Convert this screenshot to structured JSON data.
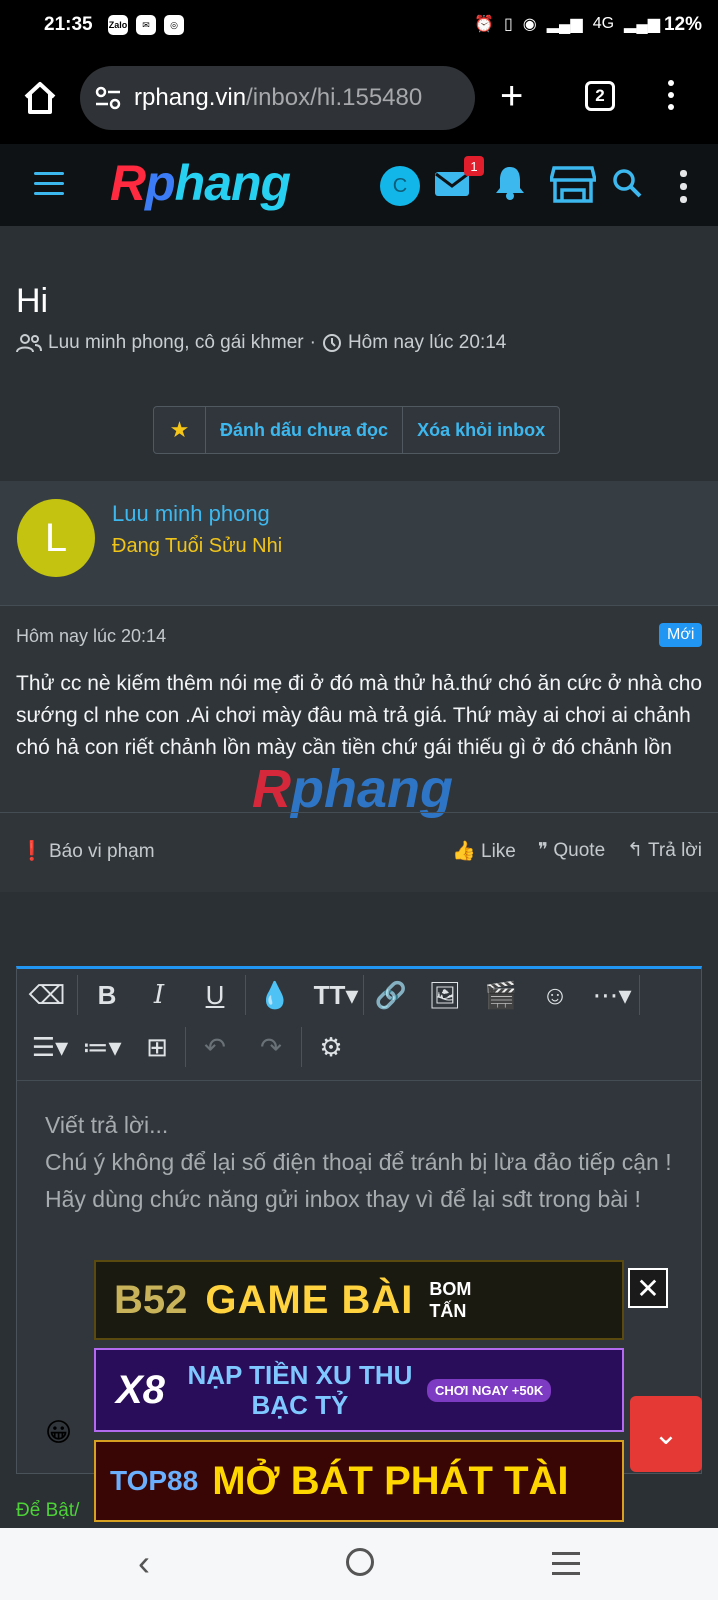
{
  "status_bar": {
    "time": "21:35",
    "network": "4G",
    "battery": "12%",
    "app_icons": [
      "Zalo",
      "Messenger",
      "Instagram"
    ]
  },
  "browser": {
    "url_host": "rphang.vin",
    "url_path": "/inbox/hi.155480",
    "tab_count": "2"
  },
  "site": {
    "logo_r": "R",
    "logo_p": "p",
    "logo_rest": "hang",
    "avatar_letter": "C",
    "mail_badge": "1"
  },
  "thread": {
    "title": "Hi",
    "participants": "Luu minh phong, cô gái khmer",
    "separator": "·",
    "time": "Hôm nay lúc 20:14",
    "buttons": {
      "mark_unread": "Đánh dấu chưa đọc",
      "remove": "Xóa khỏi inbox"
    }
  },
  "post": {
    "avatar_letter": "L",
    "author": "Luu minh phong",
    "user_title": "Đang Tuổi Sửu Nhi",
    "date": "Hôm nay lúc 20:14",
    "new_badge": "Mới",
    "body": "Thử cc nè kiếm thêm nói mẹ đi ở đó mà thử hả.thứ chó ăn cức ở nhà cho sướng cl nhe con .Ai chơi mày đâu mà trả giá. Thứ mày ai chơi ai chảnh chó hả con riết chảnh lồn mày cần tiền chứ gái thiếu gì ở đó chảnh lồn",
    "watermark_r": "R",
    "watermark_rest": "phang",
    "report": "Báo vi phạm",
    "like": "Like",
    "quote": "Quote",
    "reply": "Trả lời"
  },
  "editor": {
    "placeholder_line1": "Viết trả lời...",
    "placeholder_line2": "Chú ý không để lại số điện thoại để tránh bị lừa đảo tiếp cận !",
    "placeholder_line3": "Hãy dùng chức năng gửi inbox thay vì để lại sđt trong bài !"
  },
  "ads": {
    "ad1_brand": "B52",
    "ad1_text": "GAME BÀI",
    "ad1_tag": "BOM TẤN",
    "ad2_brand": "X8",
    "ad2_text": "NẠP TIỀN XU THU BẠC TỶ",
    "ad2_tag": "CHƠI NGAY +50K",
    "ad3_brand": "TOP88",
    "ad3_text": "MỞ BÁT PHÁT TÀI"
  },
  "hint": "Để Bật/",
  "colors": {
    "accent": "#3db8ef",
    "page_bg": "#2b3034",
    "user_title": "#f0c419",
    "new_badge": "#2196f3",
    "scroll_btn": "#e53935"
  }
}
